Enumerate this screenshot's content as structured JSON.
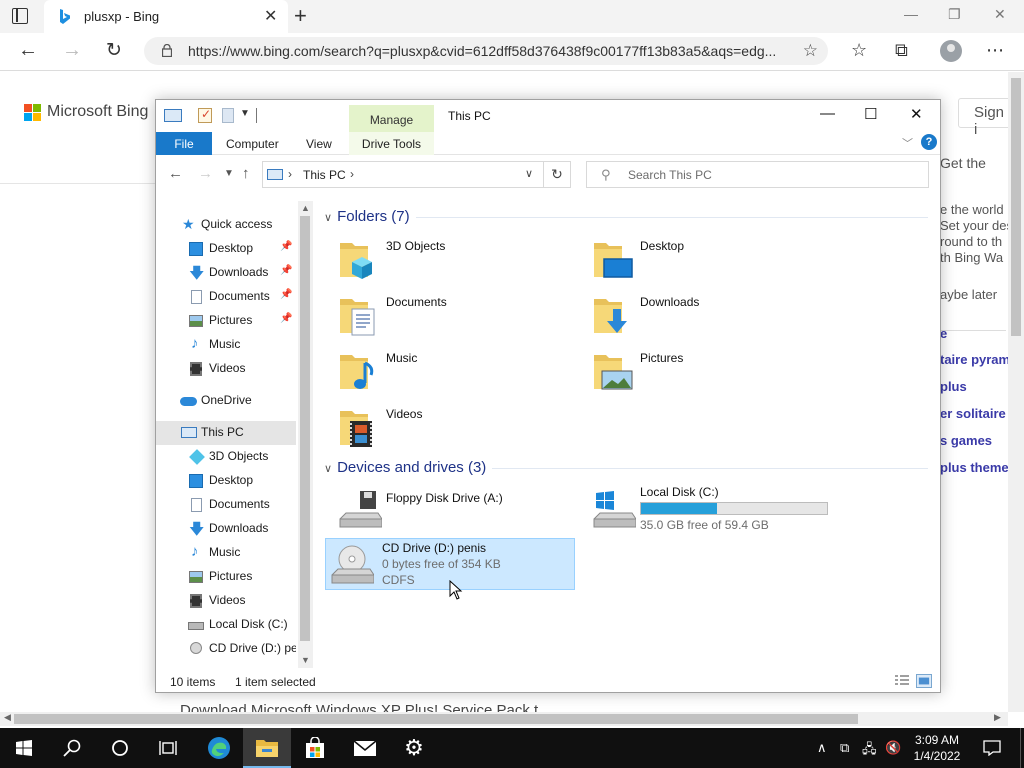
{
  "browser": {
    "tab_title": "plusxp - Bing",
    "url": "https://www.bing.com/search?q=plusxp&cvid=612dff58d376438f9c00177ff13b83a5&aqs=edg...",
    "min_icon": "—",
    "restore_icon": "❐",
    "close_icon": "✕"
  },
  "bing": {
    "logo": "Microsoft Bing",
    "sign_in": "Sign i",
    "panel": {
      "get_the": "Get the",
      "lines": [
        "e the world",
        "Set your des",
        "round to th",
        "th Bing Wa"
      ],
      "maybe_later": "aybe later",
      "links": [
        "e",
        "taire pyram",
        "plus",
        "er solitaire",
        "s games",
        "plus themes"
      ]
    },
    "bottom_text": "Download Microsoft Windows XP Plus! Service Pack t"
  },
  "explorer": {
    "title": "This PC",
    "manage_tab": "Manage",
    "drive_tools_tab": "Drive Tools",
    "ribbon_tabs": {
      "file": "File",
      "computer": "Computer",
      "view": "View"
    },
    "help": "?",
    "address": {
      "location": "This PC"
    },
    "search_placeholder": "Search This PC",
    "nav": {
      "quick_access": "Quick access",
      "qa_items": [
        "Desktop",
        "Downloads",
        "Documents",
        "Pictures",
        "Music",
        "Videos"
      ],
      "onedrive": "OneDrive",
      "this_pc": "This PC",
      "pc_items": [
        "3D Objects",
        "Desktop",
        "Documents",
        "Downloads",
        "Music",
        "Pictures",
        "Videos",
        "Local Disk (C:)",
        "CD Drive (D:) penis"
      ]
    },
    "folders_header": "Folders (7)",
    "folders": [
      "3D Objects",
      "Desktop",
      "Documents",
      "Downloads",
      "Music",
      "Pictures",
      "Videos"
    ],
    "devices_header": "Devices and drives (3)",
    "drives": {
      "floppy": {
        "name": "Floppy Disk Drive (A:)"
      },
      "local": {
        "name": "Local Disk (C:)",
        "free": "35.0 GB free of 59.4 GB",
        "used_fraction": 0.41
      },
      "cd": {
        "name": "CD Drive (D:) penis",
        "free": "0 bytes free of 354 KB",
        "fs": "CDFS"
      }
    },
    "status": {
      "items": "10 items",
      "selected": "1 item selected"
    }
  },
  "taskbar": {
    "time": "3:09 AM",
    "date": "1/4/2022"
  },
  "colors": {
    "accent": "#1979ca",
    "selection": "#cce8ff",
    "manage_green": "#e4f3cb",
    "drive_bar": "#26a0da",
    "taskbar": "#101010"
  }
}
